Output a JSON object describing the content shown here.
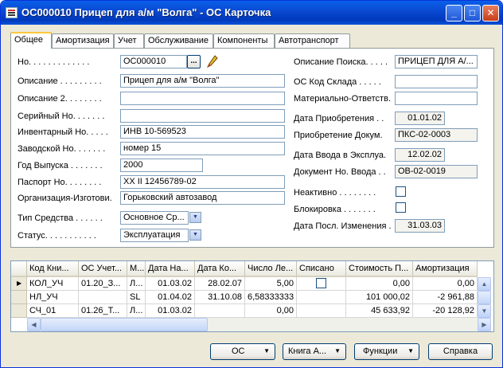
{
  "window": {
    "title": "ОС000010 Прицеп для а/м \"Волга\" - ОС Карточка",
    "minimize": "_",
    "maximize": "□",
    "close": "✕"
  },
  "tabs": [
    "Общее",
    "Амортизация",
    "Учет",
    "Обслуживание",
    "Компоненты",
    "Автотранспорт"
  ],
  "left_fields": [
    {
      "label": "Но. . . . . . . . . . . . .",
      "value": "ОС000010"
    },
    {
      "label": "Описание . . . . . . . . .",
      "value": "Прицеп для а/м \"Волга\""
    },
    {
      "label": "Описание 2. . . . . . . .",
      "value": ""
    },
    {
      "label": "Серийный Но. . . . . . .",
      "value": ""
    },
    {
      "label": "Инвентарный Но. . . . .",
      "value": "ИНВ 10-569523"
    },
    {
      "label": "Заводской Но. . . . . . .",
      "value": "номер 15"
    },
    {
      "label": "Год Выпуска . . . . . . .",
      "value": "2000"
    },
    {
      "label": "Паспорт Но. . . . . . . .",
      "value": "ХХ II 12456789-02"
    },
    {
      "label": "Организация-Изготови.",
      "value": "Горьковский автозавод"
    },
    {
      "label": "Тип Средства . . . . . .",
      "value": "Основное Ср..."
    },
    {
      "label": "Статус. . . . . . . . . . .",
      "value": "Эксплуатация"
    }
  ],
  "right_fields": [
    {
      "label": "Описание Поиска. . . . .",
      "value": "ПРИЦЕП ДЛЯ А/..."
    },
    {
      "label": "ОС Код Склада . . . . .",
      "value": ""
    },
    {
      "label": "Материально-Ответств.",
      "value": ""
    },
    {
      "label": "Дата Приобретения . .",
      "value": "01.01.02"
    },
    {
      "label": "Приобретение Докум.",
      "value": "ПКС-02-0003"
    },
    {
      "label": "Дата Ввода в Эксплуа.",
      "value": "12.02.02"
    },
    {
      "label": "Документ Но. Ввода . .",
      "value": "ОВ-02-0019"
    },
    {
      "label": "Неактивно . . . . . . . .",
      "value": ""
    },
    {
      "label": "Блокировка . . . . . . .",
      "value": ""
    },
    {
      "label": "Дата Посл. Изменения .",
      "value": "31.03.03"
    }
  ],
  "grid": {
    "headers": [
      "Код Кни...",
      "ОС Учет...",
      "М...",
      "Дата На...",
      "Дата Ко...",
      "Число Ле...",
      "Списано",
      "Стоимость П...",
      "Амортизация"
    ],
    "rows": [
      [
        "КОЛ_УЧ",
        "01.20_З...",
        "Л...",
        "01.03.02",
        "28.02.07",
        "5,00",
        "",
        "0,00",
        "0,00"
      ],
      [
        "НЛ_УЧ",
        "",
        "SL",
        "01.04.02",
        "31.10.08",
        "6,58333333",
        "",
        "101 000,02",
        "-2 961,88"
      ],
      [
        "СЧ_01",
        "01.26_Т...",
        "Л...",
        "01.03.02",
        "",
        "0,00",
        "",
        "45 633,92",
        "-20 128,92"
      ]
    ],
    "current_row_marker": "▶"
  },
  "buttons": {
    "os": "ОС",
    "book": "Книга А...",
    "functions": "Функции",
    "help": "Справка"
  },
  "icons": {
    "ellipsis": "...",
    "dropdown": "▼",
    "up": "▲",
    "down": "▼",
    "left": "◀",
    "right": "▶"
  }
}
